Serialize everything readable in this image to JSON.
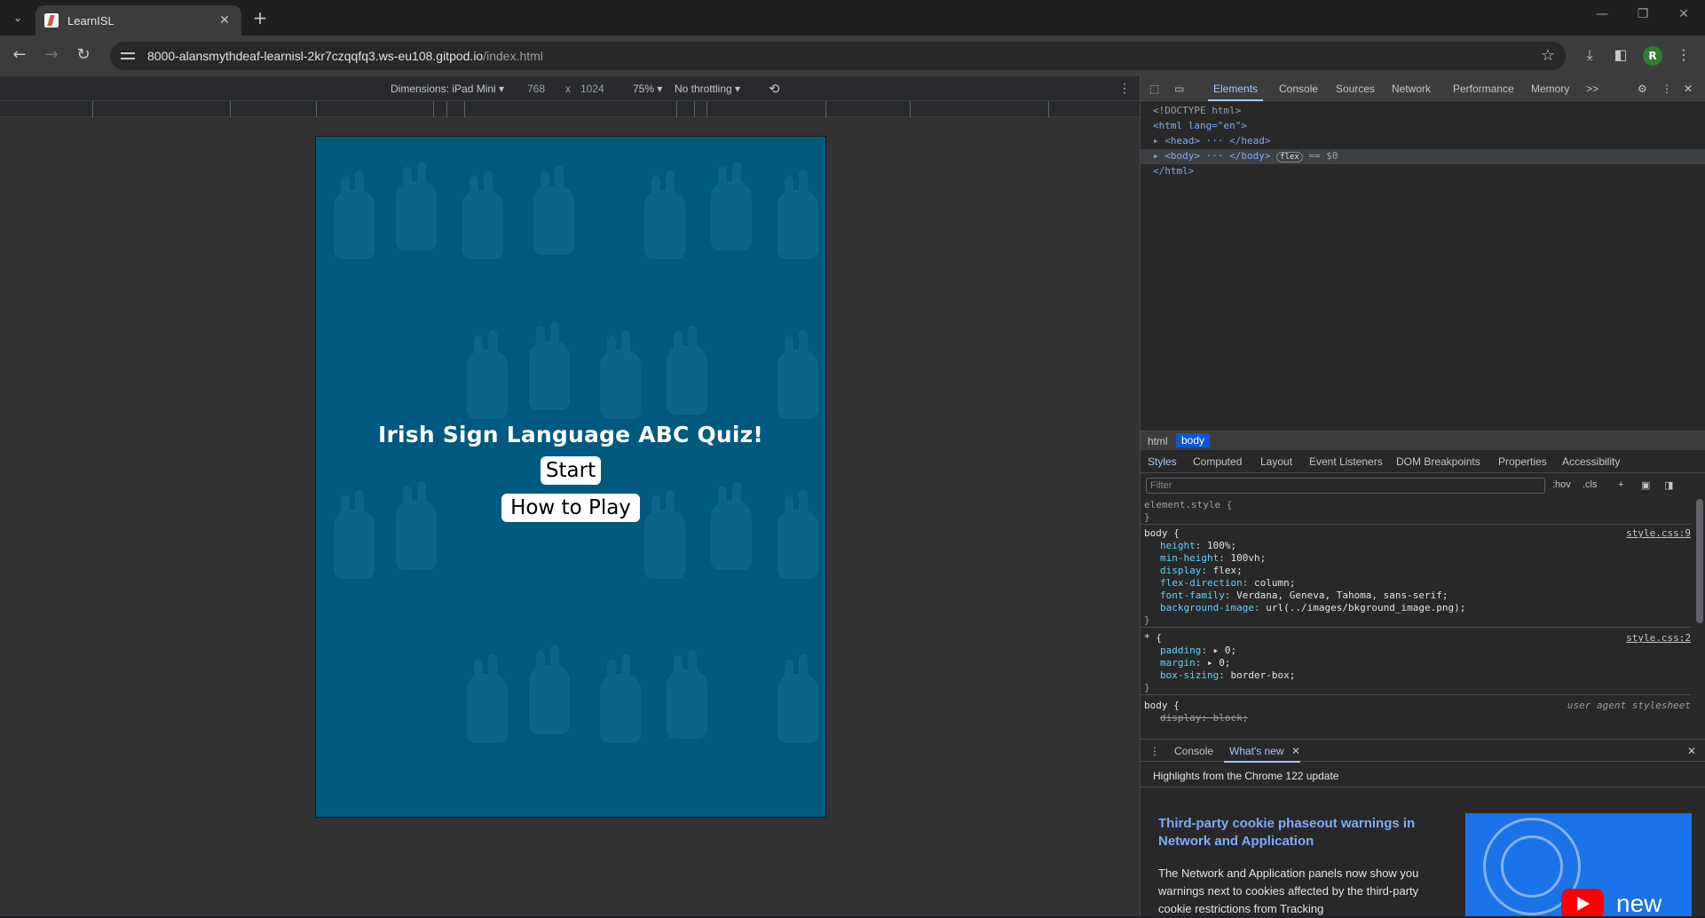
{
  "browser": {
    "tab_title": "LearnISL",
    "url_host": "8000-alansmythdeaf-learnisl-2kr7czqqfq3.ws-eu108.gitpod.io",
    "url_path": "/index.html",
    "avatar_letter": "R"
  },
  "device_toolbar": {
    "dimensions_label": "Dimensions: iPad Mini",
    "width": "768",
    "times": "x",
    "height": "1024",
    "zoom": "75%",
    "throttling": "No throttling"
  },
  "page": {
    "heading": "Irish Sign Language ABC Quiz!",
    "start_button": "Start",
    "howto_button": "How to Play",
    "background_color": "#005a80"
  },
  "devtools": {
    "tabs": [
      "Elements",
      "Console",
      "Sources",
      "Network",
      "Performance",
      "Memory",
      ">>"
    ],
    "dom": {
      "doctype": "<!DOCTYPE html>",
      "html_open": "<html lang=\"en\">",
      "head": "<head> ··· </head>",
      "body": "<body> ··· </body>",
      "flex_badge": "flex",
      "sel_marker": "== $0",
      "html_close": "</html>"
    },
    "breadcrumb": [
      "html",
      "body"
    ],
    "subtabs": [
      "Styles",
      "Computed",
      "Layout",
      "Event Listeners",
      "DOM Breakpoints",
      "Properties",
      "Accessibility"
    ],
    "filter_placeholder": "Filter",
    "hov": ":hov",
    "cls": ".cls",
    "styles": {
      "element_style": "element.style {",
      "close": "}",
      "body_rule": "body {",
      "body_src": "style.css:9",
      "body_props": [
        [
          "height",
          "100%;"
        ],
        [
          "min-height",
          "100vh;"
        ],
        [
          "display",
          "flex;"
        ],
        [
          "flex-direction",
          "column;"
        ],
        [
          "font-family",
          "Verdana, Geneva, Tahoma, sans-serif;"
        ],
        [
          "background-image",
          "url(../images/bkground_image.png);"
        ]
      ],
      "star_rule": "* {",
      "star_src": "style.css:2",
      "star_props": [
        [
          "padding",
          "▸ 0;"
        ],
        [
          "margin",
          "▸ 0;"
        ],
        [
          "box-sizing",
          "border-box;"
        ]
      ],
      "ua_rule": "body {",
      "ua_src": "user agent stylesheet",
      "ua_prop": "display: block;"
    },
    "drawer": {
      "tabs": [
        "Console",
        "What's new"
      ],
      "highlights": "Highlights from the Chrome 122 update",
      "news_title": "Third-party cookie phaseout warnings in Network and Application",
      "news_body": "The Network and Application panels now show you warnings next to cookies affected by the third-party cookie restrictions from Tracking",
      "thumb_word": "new"
    }
  }
}
